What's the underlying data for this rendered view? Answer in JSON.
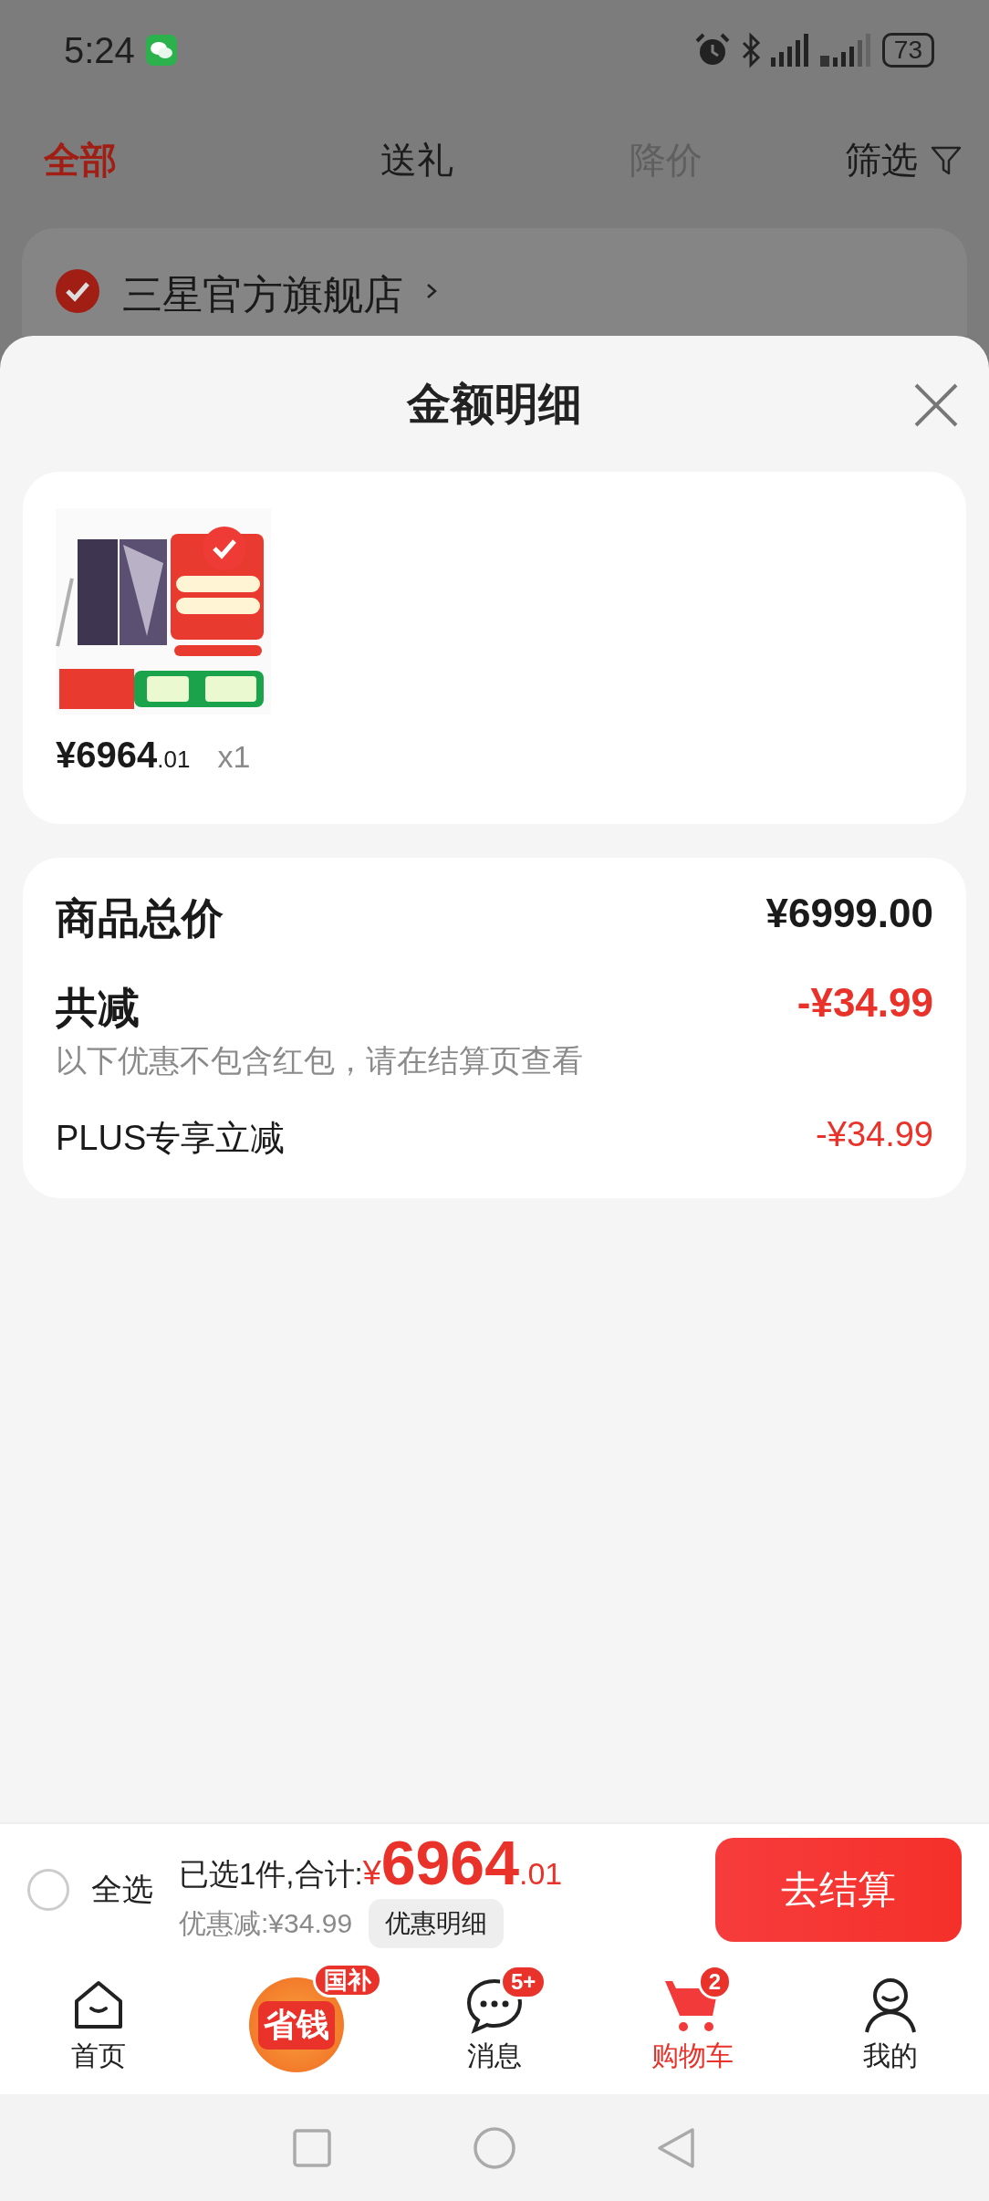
{
  "status_bar": {
    "time": "5:24",
    "battery": "73"
  },
  "tabs": [
    {
      "label": "全部",
      "selected": true,
      "disabled": false
    },
    {
      "label": "送礼",
      "selected": false,
      "disabled": false
    },
    {
      "label": "降价",
      "selected": false,
      "disabled": true
    }
  ],
  "filter": {
    "label": "筛选"
  },
  "store": {
    "name": "三星官方旗舰店",
    "checked": true
  },
  "sheet": {
    "title": "金额明细"
  },
  "product": {
    "selected": true,
    "price_main": "¥6964",
    "price_decimal": ".01",
    "quantity": "x1"
  },
  "summary": [
    {
      "kind": "total",
      "label": "商品总价",
      "value": "¥6999.00"
    },
    {
      "kind": "discount_total",
      "label": "共减",
      "note": "以下优惠不包含红包，请在结算页查看",
      "value": "-¥34.99"
    },
    {
      "kind": "discount_item",
      "label": "PLUS专享立减",
      "value": "-¥34.99"
    }
  ],
  "checkout": {
    "select_all": {
      "label": "全选",
      "checked": false
    },
    "summary_label": "已选1件,合计:",
    "currency": "¥",
    "total_main": "6964",
    "total_decimal": ".01",
    "discount_label": "优惠减:¥34.99",
    "details_button": "优惠明细",
    "checkout_button": "去结算"
  },
  "bottom_nav": [
    {
      "kind": "home",
      "label": "首页",
      "selected": false
    },
    {
      "kind": "promo",
      "label": "省钱",
      "badge": "国补",
      "selected": false
    },
    {
      "kind": "messages",
      "label": "消息",
      "badge": "5+",
      "selected": false
    },
    {
      "kind": "cart",
      "label": "购物车",
      "badge": "2",
      "selected": true
    },
    {
      "kind": "profile",
      "label": "我的",
      "selected": false
    }
  ]
}
